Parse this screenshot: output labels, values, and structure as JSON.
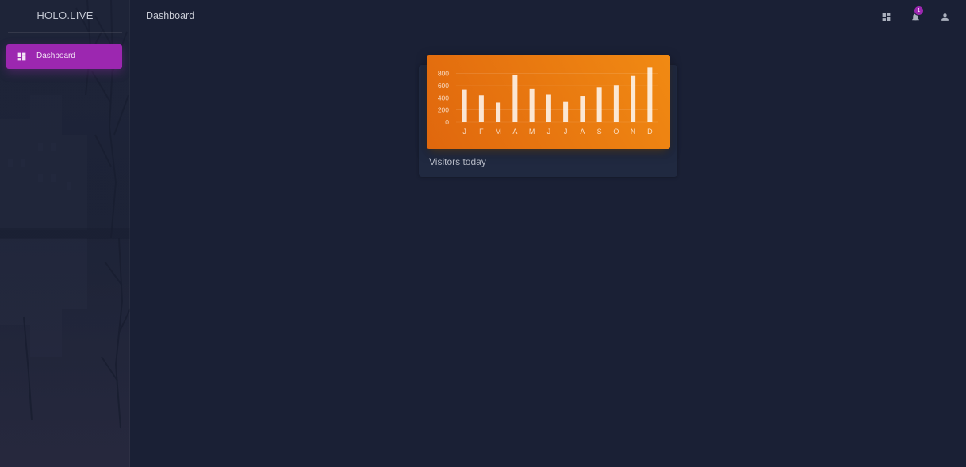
{
  "sidebar": {
    "brand": "HOLO.LIVE",
    "items": [
      {
        "label": "Dashboard",
        "icon": "dashboard-icon",
        "active": true
      }
    ]
  },
  "header": {
    "title": "Dashboard",
    "actions": [
      {
        "icon": "dashboard-icon"
      },
      {
        "icon": "bell-icon",
        "badge": "1"
      },
      {
        "icon": "person-icon"
      }
    ]
  },
  "colors": {
    "accent": "#9c27b0",
    "card_header": "#f0860f",
    "background": "#1a2035",
    "card": "#202940"
  },
  "card": {
    "title": "Visitors today"
  },
  "chart_data": {
    "type": "bar",
    "categories": [
      "J",
      "F",
      "M",
      "A",
      "M",
      "J",
      "J",
      "A",
      "S",
      "O",
      "N",
      "D"
    ],
    "values": [
      540,
      440,
      320,
      780,
      550,
      450,
      330,
      430,
      570,
      610,
      760,
      895
    ],
    "yticks": [
      "0",
      "200",
      "400",
      "600",
      "800"
    ],
    "ylim": [
      0,
      900
    ],
    "grid": true,
    "title": "",
    "xlabel": "",
    "ylabel": ""
  }
}
